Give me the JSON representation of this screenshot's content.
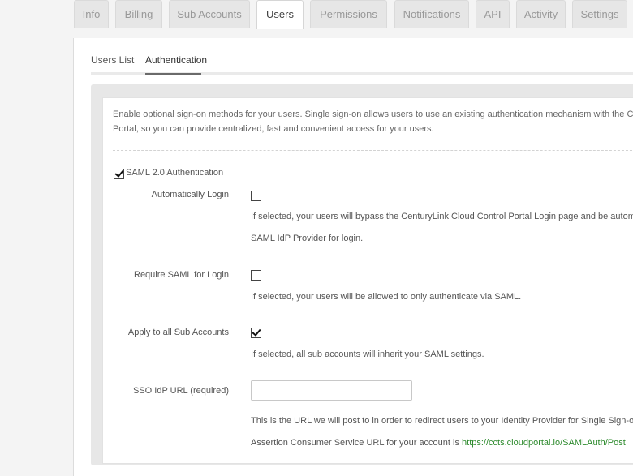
{
  "tabs": [
    {
      "label": "Info",
      "active": false
    },
    {
      "label": "Billing",
      "active": false
    },
    {
      "label": "Sub Accounts",
      "active": false
    },
    {
      "label": "Users",
      "active": true
    },
    {
      "label": "Permissions",
      "active": false
    },
    {
      "label": "Notifications",
      "active": false
    },
    {
      "label": "API",
      "active": false
    },
    {
      "label": "Activity",
      "active": false
    },
    {
      "label": "Settings",
      "active": false
    }
  ],
  "subnav": {
    "users_list": "Users List",
    "authentication": "Authentication",
    "active": "Authentication"
  },
  "intro": {
    "line1": "Enable optional sign-on methods for your users. Single sign-on allows users to use an existing authentication mechanism with the Ce",
    "line2": "Portal, so you can provide centralized, fast and convenient access for your users."
  },
  "saml": {
    "label": "SAML 2.0 Authentication",
    "checked": true
  },
  "auto_login": {
    "label": "Automatically Login",
    "checked": false,
    "help_line1": "If selected, your users will bypass the CenturyLink Cloud Control Portal Login page and be automa",
    "help_line2": "SAML IdP Provider for login."
  },
  "require_saml": {
    "label": "Require SAML for Login",
    "checked": false,
    "help": "If selected, your users will be allowed to only authenticate via SAML."
  },
  "apply_sub": {
    "label": "Apply to all Sub Accounts",
    "checked": true,
    "help": "If selected, all sub accounts will inherit your SAML settings."
  },
  "sso_url": {
    "label": "SSO IdP URL (required)",
    "value": "",
    "help": "This is the URL we will post to in order to redirect users to your Identity Provider for Single Sign-o",
    "acs_prefix": "Assertion Consumer Service URL for your account is ",
    "acs_url": "https://ccts.cloudportal.io/SAMLAuth/Post"
  },
  "colors": {
    "link": "#2d8a2d",
    "background": "#f4f4f4"
  }
}
